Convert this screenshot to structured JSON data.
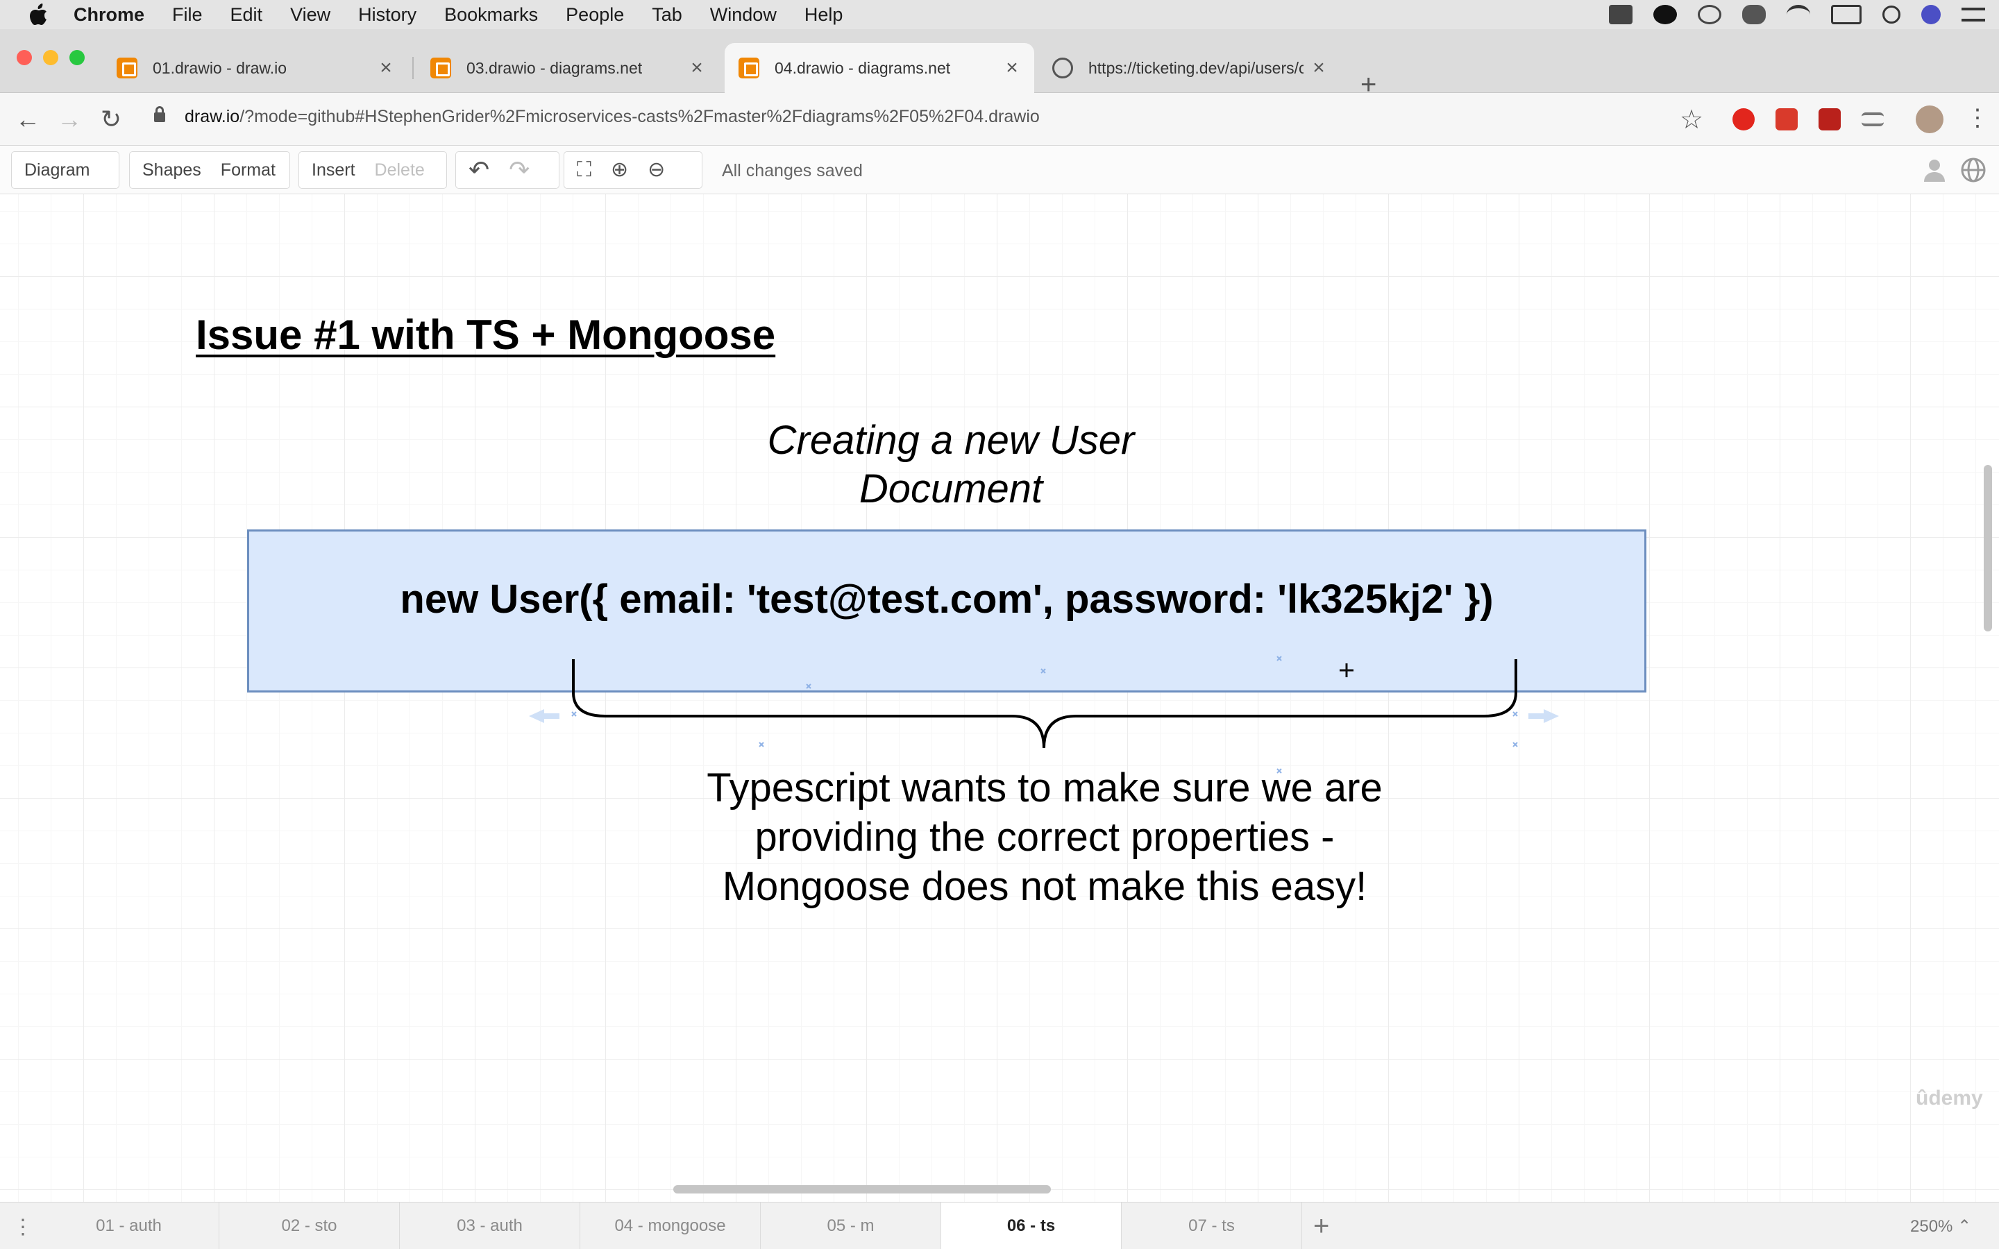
{
  "menubar": {
    "app_name": "Chrome",
    "items": [
      "File",
      "Edit",
      "View",
      "History",
      "Bookmarks",
      "People",
      "Tab",
      "Window",
      "Help"
    ]
  },
  "tabs": [
    {
      "title": "01.drawio - draw.io",
      "favicon": "drawio-icon"
    },
    {
      "title": "03.drawio - diagrams.net",
      "favicon": "drawio-icon"
    },
    {
      "title": "04.drawio - diagrams.net",
      "favicon": "drawio-icon",
      "active": true
    },
    {
      "title": "https://ticketing.dev/api/users/c",
      "favicon": "globe-icon"
    }
  ],
  "omnibox": {
    "host": "draw.io",
    "path": "/?mode=github#HStephenGrider%2Fmicroservices-casts%2Fmaster%2Fdiagrams%2F05%2F04.drawio"
  },
  "drawio_toolbar": {
    "diagram": "Diagram",
    "shapes": "Shapes",
    "format": "Format",
    "insert": "Insert",
    "delete": "Delete",
    "status": "All changes saved"
  },
  "canvas": {
    "heading": "Issue #1 with TS + Mongoose",
    "subtitle_line1": "Creating a new User",
    "subtitle_line2": "Document",
    "code": "new User({ email: 'test@test.com', password: 'lk325kj2' })",
    "note_line1": "Typescript wants to make sure we are",
    "note_line2": "providing the correct properties -",
    "note_line3": "Mongoose does not make this easy!",
    "watermark": "ûdemy"
  },
  "pages": [
    "01 - auth",
    "02 - sto",
    "03 - auth",
    "04 - mongoose",
    "05 - m",
    "06 - ts",
    "07 - ts"
  ],
  "active_page": "06 - ts",
  "zoom": "250%",
  "colors": {
    "box_fill": "#dae8fc",
    "box_stroke": "#6c8ebf",
    "drawio_orange": "#f08705"
  }
}
